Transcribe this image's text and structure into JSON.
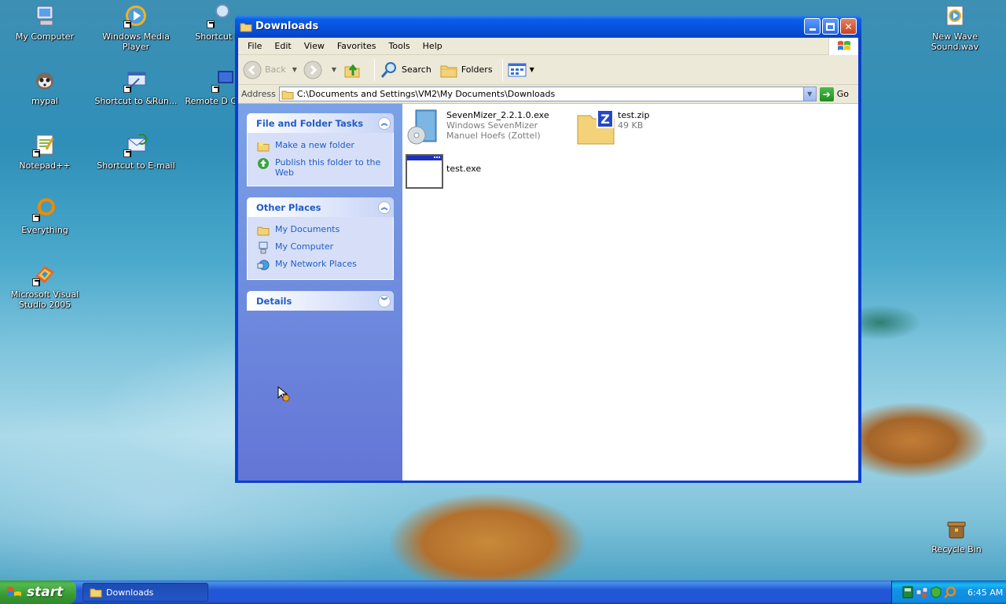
{
  "desktop": {
    "icons": [
      {
        "label": "My Computer"
      },
      {
        "label": "Windows Media Player"
      },
      {
        "label": "Shortcut to"
      },
      {
        "label": "mypal"
      },
      {
        "label": "Shortcut to &Run..."
      },
      {
        "label": "Remote D Connec"
      },
      {
        "label": "Notepad++"
      },
      {
        "label": "Shortcut to E-mail"
      },
      {
        "label": "Everything"
      },
      {
        "label": "Microsoft Visual Studio 2005"
      },
      {
        "label": "New Wave Sound.wav"
      },
      {
        "label": "Recycle Bin"
      }
    ]
  },
  "window": {
    "title": "Downloads",
    "menu": [
      "File",
      "Edit",
      "View",
      "Favorites",
      "Tools",
      "Help"
    ],
    "toolbar": {
      "back": "Back",
      "search": "Search",
      "folders": "Folders"
    },
    "address": {
      "label": "Address",
      "value": "C:\\Documents and Settings\\VM2\\My Documents\\Downloads",
      "go": "Go"
    },
    "tasks": {
      "file_folder": {
        "title": "File and Folder Tasks",
        "items": [
          "Make a new folder",
          "Publish this folder to the Web"
        ]
      },
      "other_places": {
        "title": "Other Places",
        "items": [
          "My Documents",
          "My Computer",
          "My Network Places"
        ]
      },
      "details": {
        "title": "Details"
      }
    },
    "files": [
      {
        "name": "SevenMizer_2.2.1.0.exe",
        "line2": "Windows SevenMizer",
        "line3": "Manuel Hoefs (Zottel)",
        "icon": "installer-cd-icon"
      },
      {
        "name": "test.zip",
        "line2": "49 KB",
        "icon": "zip-folder-icon"
      },
      {
        "name": "test.exe",
        "icon": "exe-window-icon"
      }
    ]
  },
  "taskbar": {
    "start": "start",
    "task": "Downloads",
    "clock": "6:45 AM"
  },
  "colors": {
    "title_bar": "#0650dc",
    "task_pane_link": "#215dc6",
    "start_green": "#3a9b36",
    "taskbar_blue": "#2157d7"
  }
}
